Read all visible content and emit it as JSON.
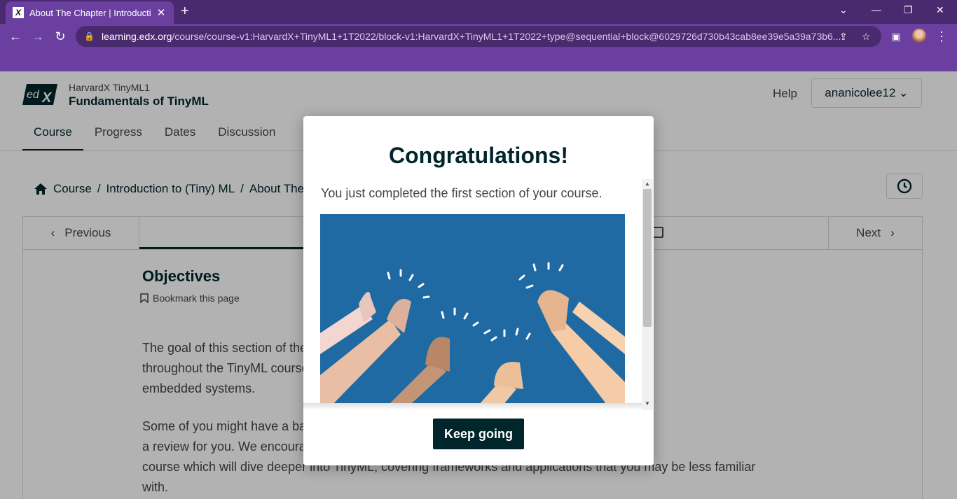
{
  "browser": {
    "tab_title": "About The Chapter | Introduction to (Tiny) ML",
    "tab_favicon_letter": "X",
    "url_host": "learning.edx.org",
    "url_path": "/course/course-v1:HarvardX+TinyML1+1T2022/block-v1:HarvardX+TinyML1+1T2022+type@sequential+block@6029726d730b43cab8ee39e5a39a73b6...",
    "new_tab_glyph": "+",
    "close_glyph": "✕"
  },
  "header": {
    "course_org": "HarvardX TinyML1",
    "course_name": "Fundamentals of TinyML",
    "help_label": "Help",
    "username": "ananicolee12"
  },
  "course_tabs": [
    {
      "label": "Course",
      "active": true
    },
    {
      "label": "Progress",
      "active": false
    },
    {
      "label": "Dates",
      "active": false
    },
    {
      "label": "Discussion",
      "active": false
    }
  ],
  "breadcrumb": {
    "home_label": "Course",
    "section_label": "Introduction to (Tiny) ML",
    "current_label": "About The Chapter",
    "separator": "/"
  },
  "sequence_nav": {
    "previous_label": "Previous",
    "next_label": "Next"
  },
  "content": {
    "title": "Objectives",
    "bookmark_label": "Bookmark this page",
    "para1_lines": [
      "The goal of this section of the course is to introduce the concepts we will be using",
      "throughout the TinyML course, which are at the intersection of machine learning and",
      "embedded systems."
    ],
    "para2_lines": [
      "Some of you might have a background in these areas, so this section will be more of",
      "a review for you. We encourage you to go through it and get excited for the next",
      "course which will dive deeper into TinyML, covering frameworks and applications that you may be less familiar",
      "with."
    ]
  },
  "modal": {
    "title": "Congratulations!",
    "message": "You just completed the first section of your course.",
    "image_alt": "clapping-hands-illustration",
    "button_label": "Keep going"
  }
}
